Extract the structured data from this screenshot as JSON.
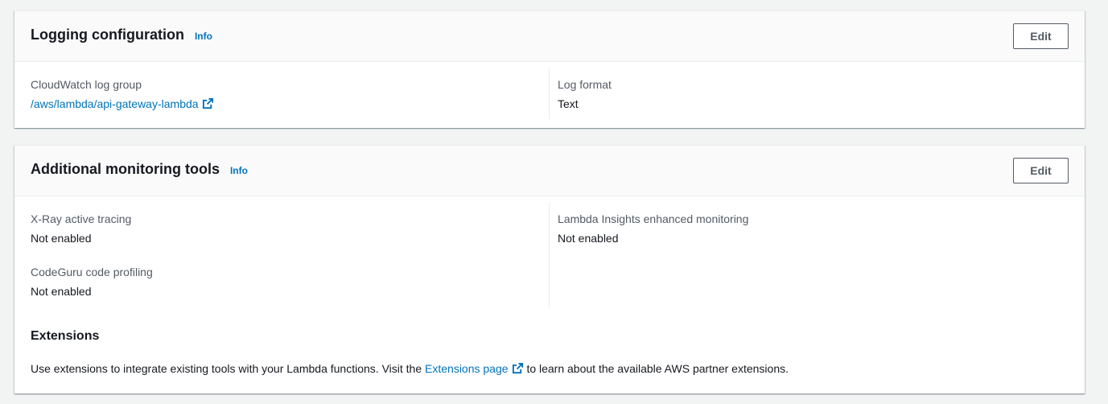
{
  "logging": {
    "title": "Logging configuration",
    "info": "Info",
    "edit": "Edit",
    "log_group_label": "CloudWatch log group",
    "log_group_value": "/aws/lambda/api-gateway-lambda",
    "log_format_label": "Log format",
    "log_format_value": "Text"
  },
  "monitoring": {
    "title": "Additional monitoring tools",
    "info": "Info",
    "edit": "Edit",
    "xray_label": "X-Ray active tracing",
    "xray_value": "Not enabled",
    "codeguru_label": "CodeGuru code profiling",
    "codeguru_value": "Not enabled",
    "insights_label": "Lambda Insights enhanced monitoring",
    "insights_value": "Not enabled",
    "extensions_title": "Extensions",
    "extensions_text_before": "Use extensions to integrate existing tools with your Lambda functions. Visit the",
    "extensions_link": "Extensions page",
    "extensions_text_after": "to learn about the available AWS partner extensions."
  },
  "colors": {
    "link": "#0073bb",
    "text": "#16191f",
    "label": "#545b64",
    "background": "#f2f3f3"
  },
  "icons": {
    "external_link": "external-link-icon"
  }
}
